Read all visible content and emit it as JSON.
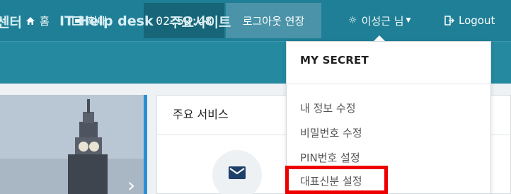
{
  "topbar": {
    "home_label": "홈",
    "zoom_label": "확대",
    "clock": "02:59:48",
    "extend_label": "로그아웃 연장",
    "user_label": "이성근 님",
    "logout_label": "Logout"
  },
  "nav": {
    "items": [
      {
        "label": "센터"
      },
      {
        "label": "IT Help desk"
      },
      {
        "label": "주요사이트"
      }
    ]
  },
  "main": {
    "services_title": "주요 서비스"
  },
  "dropdown": {
    "header": "MY SECRET",
    "items": [
      {
        "label": "내 정보 수정"
      },
      {
        "label": "비밀번호 수정"
      },
      {
        "label": "PIN번호 설정"
      },
      {
        "label": "대표신분 설정"
      }
    ]
  },
  "colors": {
    "topbar": "#1f7f96",
    "navbar": "#2589a0",
    "clock_bg": "#176578",
    "extend_bg": "#4a93a8",
    "highlight": "#ee0000"
  },
  "icons": {
    "home": "home-icon",
    "zoom": "zoom-icon",
    "user": "gear-icon",
    "logout": "logout-icon",
    "mail": "mail-icon"
  }
}
